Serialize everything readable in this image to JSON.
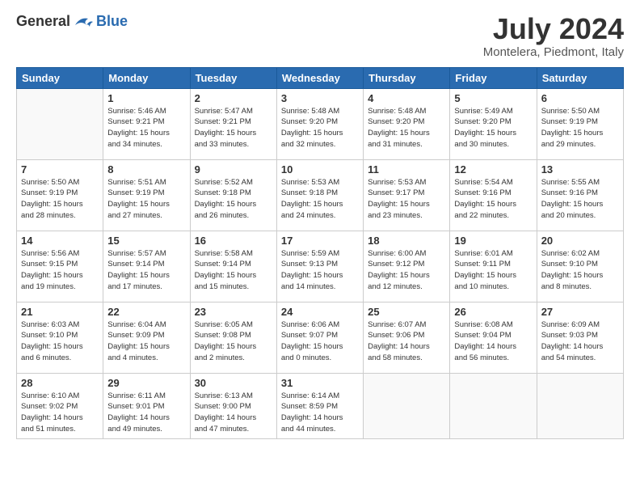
{
  "header": {
    "logo_general": "General",
    "logo_blue": "Blue",
    "title": "July 2024",
    "location": "Montelera, Piedmont, Italy"
  },
  "weekdays": [
    "Sunday",
    "Monday",
    "Tuesday",
    "Wednesday",
    "Thursday",
    "Friday",
    "Saturday"
  ],
  "weeks": [
    [
      {
        "day": "",
        "info": ""
      },
      {
        "day": "1",
        "info": "Sunrise: 5:46 AM\nSunset: 9:21 PM\nDaylight: 15 hours\nand 34 minutes."
      },
      {
        "day": "2",
        "info": "Sunrise: 5:47 AM\nSunset: 9:21 PM\nDaylight: 15 hours\nand 33 minutes."
      },
      {
        "day": "3",
        "info": "Sunrise: 5:48 AM\nSunset: 9:20 PM\nDaylight: 15 hours\nand 32 minutes."
      },
      {
        "day": "4",
        "info": "Sunrise: 5:48 AM\nSunset: 9:20 PM\nDaylight: 15 hours\nand 31 minutes."
      },
      {
        "day": "5",
        "info": "Sunrise: 5:49 AM\nSunset: 9:20 PM\nDaylight: 15 hours\nand 30 minutes."
      },
      {
        "day": "6",
        "info": "Sunrise: 5:50 AM\nSunset: 9:19 PM\nDaylight: 15 hours\nand 29 minutes."
      }
    ],
    [
      {
        "day": "7",
        "info": "Sunrise: 5:50 AM\nSunset: 9:19 PM\nDaylight: 15 hours\nand 28 minutes."
      },
      {
        "day": "8",
        "info": "Sunrise: 5:51 AM\nSunset: 9:19 PM\nDaylight: 15 hours\nand 27 minutes."
      },
      {
        "day": "9",
        "info": "Sunrise: 5:52 AM\nSunset: 9:18 PM\nDaylight: 15 hours\nand 26 minutes."
      },
      {
        "day": "10",
        "info": "Sunrise: 5:53 AM\nSunset: 9:18 PM\nDaylight: 15 hours\nand 24 minutes."
      },
      {
        "day": "11",
        "info": "Sunrise: 5:53 AM\nSunset: 9:17 PM\nDaylight: 15 hours\nand 23 minutes."
      },
      {
        "day": "12",
        "info": "Sunrise: 5:54 AM\nSunset: 9:16 PM\nDaylight: 15 hours\nand 22 minutes."
      },
      {
        "day": "13",
        "info": "Sunrise: 5:55 AM\nSunset: 9:16 PM\nDaylight: 15 hours\nand 20 minutes."
      }
    ],
    [
      {
        "day": "14",
        "info": "Sunrise: 5:56 AM\nSunset: 9:15 PM\nDaylight: 15 hours\nand 19 minutes."
      },
      {
        "day": "15",
        "info": "Sunrise: 5:57 AM\nSunset: 9:14 PM\nDaylight: 15 hours\nand 17 minutes."
      },
      {
        "day": "16",
        "info": "Sunrise: 5:58 AM\nSunset: 9:14 PM\nDaylight: 15 hours\nand 15 minutes."
      },
      {
        "day": "17",
        "info": "Sunrise: 5:59 AM\nSunset: 9:13 PM\nDaylight: 15 hours\nand 14 minutes."
      },
      {
        "day": "18",
        "info": "Sunrise: 6:00 AM\nSunset: 9:12 PM\nDaylight: 15 hours\nand 12 minutes."
      },
      {
        "day": "19",
        "info": "Sunrise: 6:01 AM\nSunset: 9:11 PM\nDaylight: 15 hours\nand 10 minutes."
      },
      {
        "day": "20",
        "info": "Sunrise: 6:02 AM\nSunset: 9:10 PM\nDaylight: 15 hours\nand 8 minutes."
      }
    ],
    [
      {
        "day": "21",
        "info": "Sunrise: 6:03 AM\nSunset: 9:10 PM\nDaylight: 15 hours\nand 6 minutes."
      },
      {
        "day": "22",
        "info": "Sunrise: 6:04 AM\nSunset: 9:09 PM\nDaylight: 15 hours\nand 4 minutes."
      },
      {
        "day": "23",
        "info": "Sunrise: 6:05 AM\nSunset: 9:08 PM\nDaylight: 15 hours\nand 2 minutes."
      },
      {
        "day": "24",
        "info": "Sunrise: 6:06 AM\nSunset: 9:07 PM\nDaylight: 15 hours\nand 0 minutes."
      },
      {
        "day": "25",
        "info": "Sunrise: 6:07 AM\nSunset: 9:06 PM\nDaylight: 14 hours\nand 58 minutes."
      },
      {
        "day": "26",
        "info": "Sunrise: 6:08 AM\nSunset: 9:04 PM\nDaylight: 14 hours\nand 56 minutes."
      },
      {
        "day": "27",
        "info": "Sunrise: 6:09 AM\nSunset: 9:03 PM\nDaylight: 14 hours\nand 54 minutes."
      }
    ],
    [
      {
        "day": "28",
        "info": "Sunrise: 6:10 AM\nSunset: 9:02 PM\nDaylight: 14 hours\nand 51 minutes."
      },
      {
        "day": "29",
        "info": "Sunrise: 6:11 AM\nSunset: 9:01 PM\nDaylight: 14 hours\nand 49 minutes."
      },
      {
        "day": "30",
        "info": "Sunrise: 6:13 AM\nSunset: 9:00 PM\nDaylight: 14 hours\nand 47 minutes."
      },
      {
        "day": "31",
        "info": "Sunrise: 6:14 AM\nSunset: 8:59 PM\nDaylight: 14 hours\nand 44 minutes."
      },
      {
        "day": "",
        "info": ""
      },
      {
        "day": "",
        "info": ""
      },
      {
        "day": "",
        "info": ""
      }
    ]
  ]
}
